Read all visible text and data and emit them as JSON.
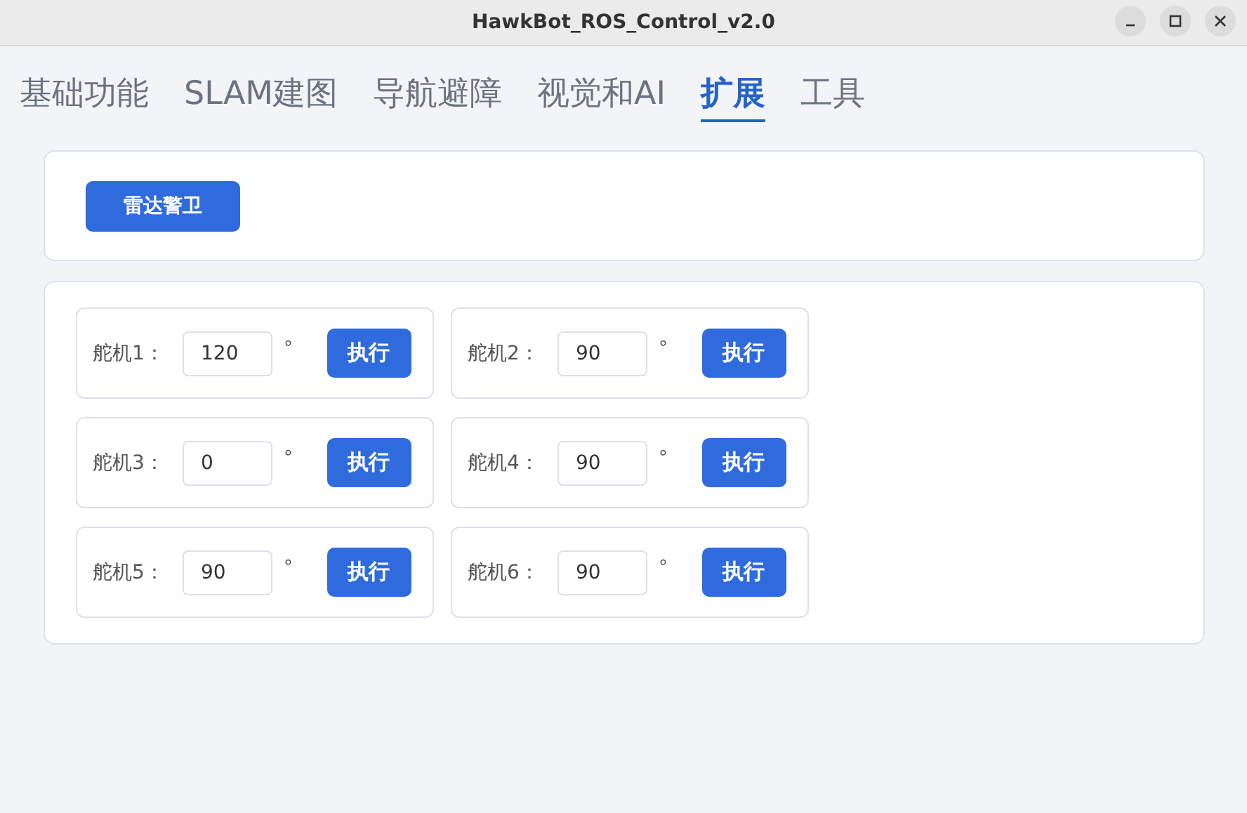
{
  "window": {
    "title": "HawkBot_ROS_Control_v2.0"
  },
  "tabs": [
    {
      "label": "基础功能",
      "selected": false
    },
    {
      "label": "SLAM建图",
      "selected": false
    },
    {
      "label": "导航避障",
      "selected": false
    },
    {
      "label": "视觉和AI",
      "selected": false
    },
    {
      "label": "扩展",
      "selected": true
    },
    {
      "label": "工具",
      "selected": false
    }
  ],
  "radar_button": "雷达警卫",
  "servos": [
    {
      "label": "舵机1：",
      "value": "120",
      "unit": "°",
      "button": "执行"
    },
    {
      "label": "舵机2：",
      "value": "90",
      "unit": "°",
      "button": "执行"
    },
    {
      "label": "舵机3：",
      "value": "0",
      "unit": "°",
      "button": "执行"
    },
    {
      "label": "舵机4：",
      "value": "90",
      "unit": "°",
      "button": "执行"
    },
    {
      "label": "舵机5：",
      "value": "90",
      "unit": "°",
      "button": "执行"
    },
    {
      "label": "舵机6：",
      "value": "90",
      "unit": "°",
      "button": "执行"
    }
  ]
}
